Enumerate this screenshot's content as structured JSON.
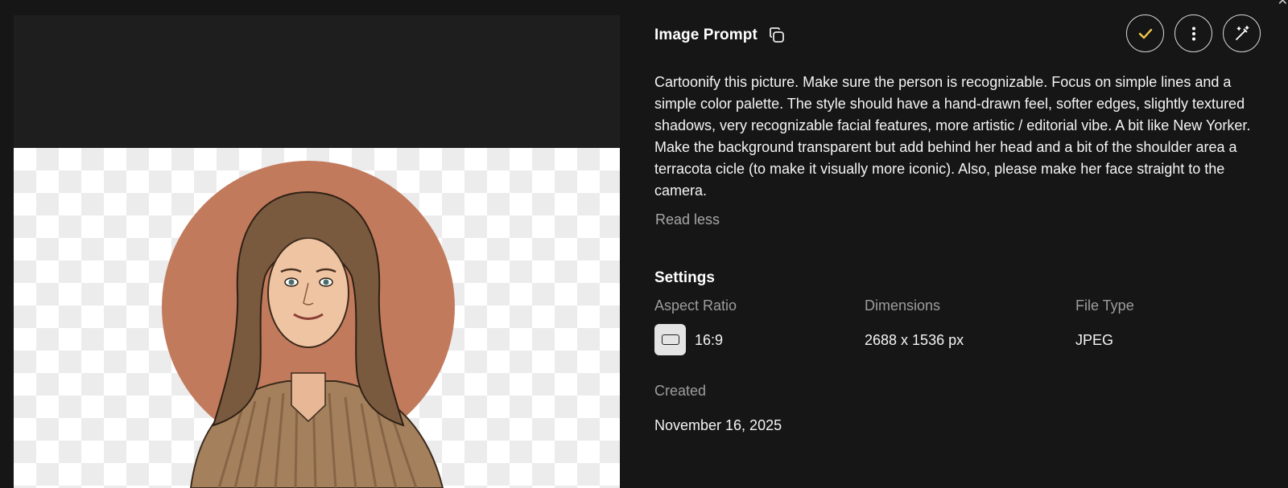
{
  "prompt": {
    "title": "Image Prompt",
    "text": "Cartoonify this picture. Make sure the person is recognizable. Focus on simple lines and a simple color palette. The style should have a hand-drawn feel, softer edges, slightly textured shadows, very recognizable facial features, more artistic / editorial vibe. A  bit like New Yorker. Make the background transparent but add behind her head and a bit of the shoulder area a terracota cicle (to make it visually more iconic). Also, please make her face straight to the camera.",
    "read_less": "Read less"
  },
  "actions": {
    "approve_icon": "check-icon",
    "more_icon": "vertical-dots-icon",
    "edit_icon": "magic-wand-icon",
    "accent": "#f2c94c"
  },
  "settings": {
    "title": "Settings",
    "aspect_ratio": {
      "label": "Aspect Ratio",
      "value": "16:9"
    },
    "dimensions": {
      "label": "Dimensions",
      "value": "2688 x 1536 px"
    },
    "file_type": {
      "label": "File Type",
      "value": "JPEG"
    }
  },
  "created": {
    "label": "Created",
    "value": "November 16, 2025"
  },
  "colors": {
    "background": "#161616",
    "circle": "#c27a5c",
    "hair": "#7a5a3e",
    "shirt": "#a4805c"
  }
}
